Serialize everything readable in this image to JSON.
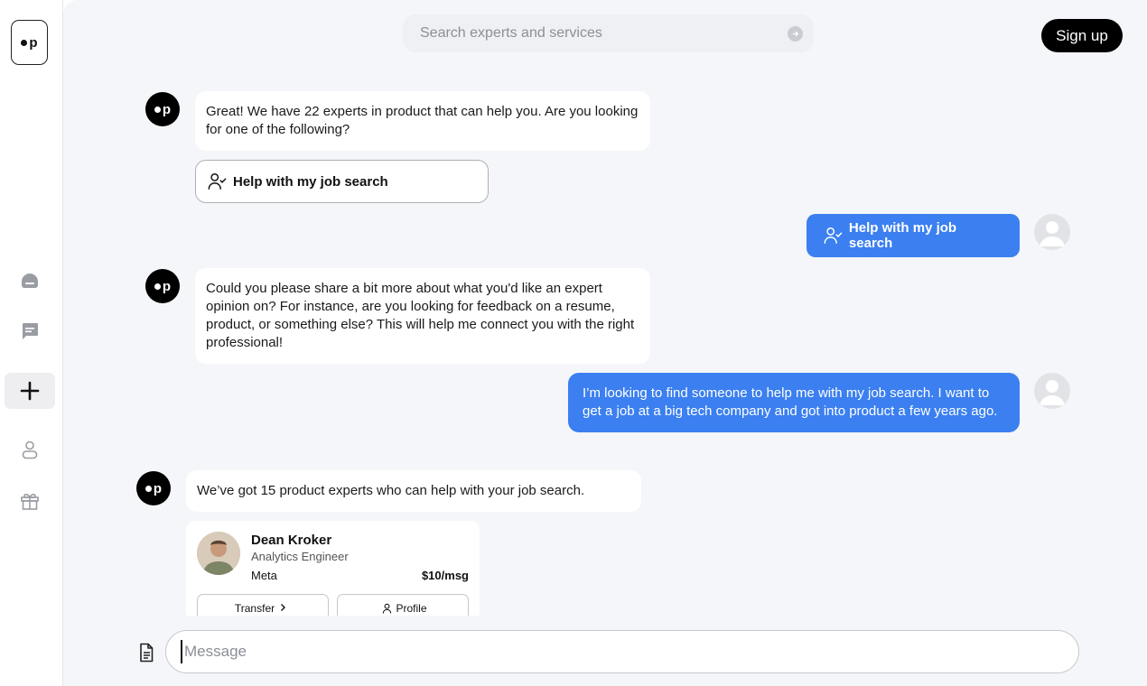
{
  "sidebar": {
    "logo_text": "p",
    "items": [
      {
        "name": "home",
        "icon": "home-icon"
      },
      {
        "name": "messages",
        "icon": "chat-icon"
      },
      {
        "name": "new",
        "icon": "plus-icon"
      },
      {
        "name": "profile",
        "icon": "user-icon"
      },
      {
        "name": "gifts",
        "icon": "gift-icon"
      }
    ]
  },
  "header": {
    "search_placeholder": "Search experts and services",
    "signup_label": "Sign up"
  },
  "chat": {
    "bot_logo_text": "p",
    "messages": [
      {
        "from": "bot",
        "text": "Great! We have 22 experts in product that can help you. Are you looking for one of the following?"
      },
      {
        "from": "bot_option",
        "text": "Help with my job search"
      },
      {
        "from": "user",
        "text": "Help with my job search"
      },
      {
        "from": "bot",
        "text": "Could you please share a bit more about what you'd like an expert opinion on? For instance, are you looking for feedback on a resume, product, or something else? This will help me connect you with the right professional!"
      },
      {
        "from": "user",
        "text": "I’m looking to find someone to help me with my job search. I want to get a job at a big tech company and got into product a few years ago."
      },
      {
        "from": "bot",
        "text": "We’ve got 15 product experts who can help with your job search."
      }
    ],
    "expert_card": {
      "name": "Dean Kroker",
      "role": "Analytics Engineer",
      "company": "Meta",
      "price": "$10/msg",
      "transfer_label": "Transfer",
      "profile_label": "Profile"
    }
  },
  "composer": {
    "placeholder": "Message"
  },
  "colors": {
    "accent": "#3b7ff0",
    "background": "#f5f6f9"
  }
}
